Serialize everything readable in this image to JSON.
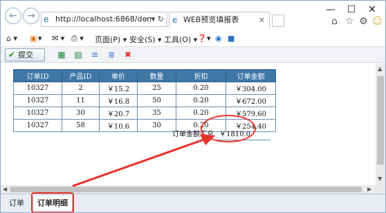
{
  "browser": {
    "address": "http://localhost:6868/dem",
    "address_controls": "⌕ ▾ ↻",
    "tab_title": "WEB预览填报表",
    "tab_close": "×",
    "minimize": "—",
    "maximize": "☐",
    "close": "✕"
  },
  "command_bar": {
    "page": "页面(P) ▾",
    "safety": "安全(S) ▾",
    "tools": "工具(O) ▾",
    "help": "▾"
  },
  "toolbar": {
    "submit_label": "提交"
  },
  "grid": {
    "headers": [
      "订单ID",
      "产品ID",
      "单价",
      "数量",
      "折扣",
      "订单金额"
    ],
    "rows": [
      [
        "10327",
        "2",
        "￥15.2",
        "25",
        "0.20",
        "￥304.00"
      ],
      [
        "10327",
        "11",
        "￥16.8",
        "50",
        "0.20",
        "￥672.00"
      ],
      [
        "10327",
        "30",
        "￥20.7",
        "35",
        "0.20",
        "￥579.60"
      ],
      [
        "10327",
        "58",
        "￥10.6",
        "30",
        "0.20",
        "￥254.40"
      ]
    ],
    "total_label": "订单金额汇总",
    "total_value": "￥1810.0"
  },
  "sheets": [
    "订单",
    "订单明细"
  ],
  "colors": {
    "header_bg": "#3f77a6",
    "annotation": "#e8312a"
  }
}
